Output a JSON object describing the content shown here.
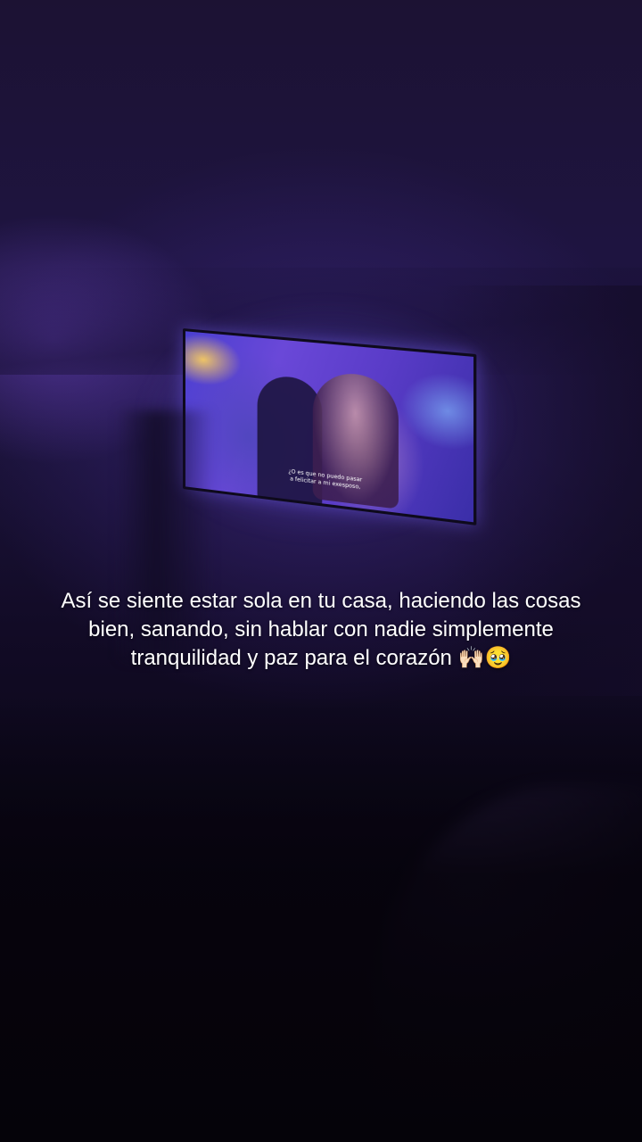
{
  "caption": {
    "text": "Así se siente estar sola en tu casa, haciendo las cosas bien, sanando, sin hablar con nadie simplemente tranquilidad y paz para el corazón 🙌🏻🥹"
  },
  "tv": {
    "subtitle": "¿O es que no puedo pasar\na felicitar a mi exesposo,"
  },
  "colors": {
    "scene_tint": "#1e1440",
    "tv_screen": "#5a3cc8",
    "caption_text": "#ffffff"
  }
}
